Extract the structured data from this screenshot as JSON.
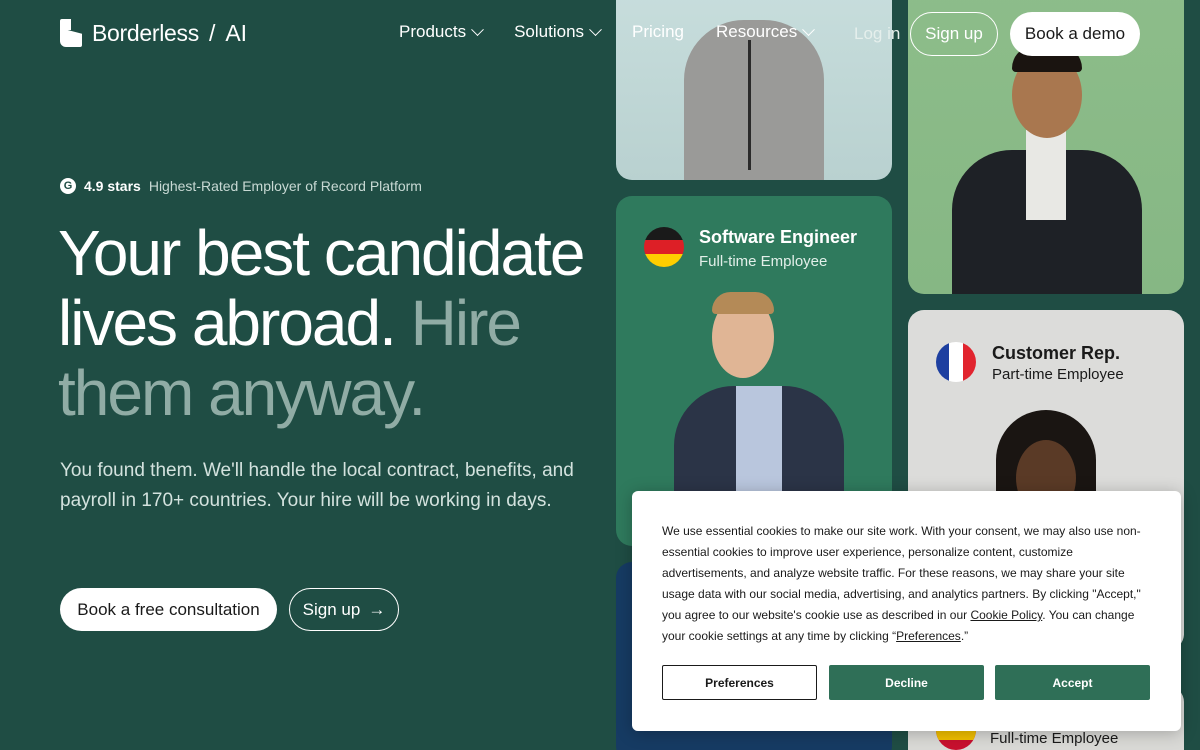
{
  "brand": {
    "name": "Borderless",
    "suffix": "AI"
  },
  "nav": {
    "links": [
      {
        "label": "Products",
        "has_dropdown": true
      },
      {
        "label": "Solutions",
        "has_dropdown": true
      },
      {
        "label": "Pricing",
        "has_dropdown": false
      },
      {
        "label": "Resources",
        "has_dropdown": true
      }
    ],
    "login": "Log in",
    "signup": "Sign up",
    "demo": "Book a demo"
  },
  "hero": {
    "rating_score": "4.9 stars",
    "rating_desc": "Highest-Rated Employer of Record Platform",
    "headline_main": "Your best candidate lives abroad.",
    "headline_muted": "Hire them anyway.",
    "subtext": "You found them. We'll handle the local contract, benefits, and payroll in 170+ countries. Your hire will be working in days.",
    "cta_primary": "Book a free consultation",
    "cta_secondary": "Sign up"
  },
  "cards": [
    {
      "role": "Software Engineer",
      "type": "Full-time Employee",
      "flag": "de-flag-icon"
    },
    {
      "role": "Customer Rep.",
      "type": "Part-time Employee",
      "flag": "fr-flag-icon"
    },
    {
      "role": "",
      "type": "Full-time Employee",
      "flag": "es-flag-icon"
    }
  ],
  "cookie": {
    "text_1": "We use essential cookies to make our site work. With your consent, we may also use non-essential cookies to improve user experience, personalize content, customize advertisements, and analyze website traffic. For these reasons, we may share your site usage data with our social media, advertising, and analytics partners. By clicking \"Accept,\" you agree to our website's cookie use as described in our ",
    "policy_link": "Cookie Policy",
    "text_2": ". You can change your cookie settings at any time by clicking “",
    "prefs_link": "Preferences",
    "text_3": ".”",
    "btn_preferences": "Preferences",
    "btn_decline": "Decline",
    "btn_accept": "Accept"
  },
  "colors": {
    "background": "#1f4d44",
    "muted_headline": "#90aca5",
    "cookie_button": "#2f6f57"
  }
}
